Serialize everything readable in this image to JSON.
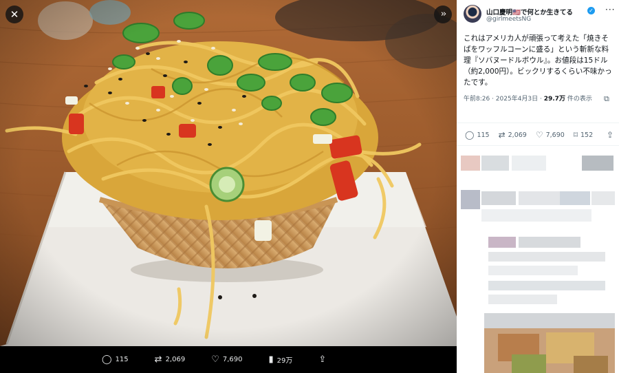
{
  "viewer": {
    "close_icon": "close-icon",
    "expand_icon": "chevrons-right-icon",
    "media_bar": {
      "replies": "115",
      "retweets": "2,069",
      "likes": "7,690",
      "views": "29万"
    }
  },
  "tweet": {
    "display_name": "山口慶明🇺🇸で何とか生きてる",
    "handle": "@girlmeetsNG",
    "verified": true,
    "text": "これはアメリカ人が頑張って考えた「焼きそばをワッフルコーンに盛る」という斬新な料理『ソバヌードルボウル』。お値段は15ドル（約2,000円）。ビックリするくらい不味かったです。",
    "meta_time": "午前8:26 · 2025年4月3日 · ",
    "meta_views_count": "29.7万",
    "meta_views_suffix": " 件の表示",
    "actions": {
      "replies": "115",
      "retweets": "2,069",
      "likes": "7,690",
      "bookmarks": "152"
    }
  },
  "colors": {
    "verified_blue": "#1d9bf0",
    "panel_text": "#0f1419",
    "muted_text": "#536471"
  }
}
